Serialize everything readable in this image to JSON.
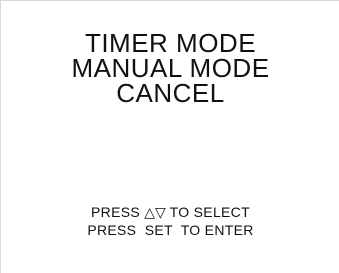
{
  "menu": {
    "items": [
      {
        "label": "TIMER MODE"
      },
      {
        "label": "MANUAL MODE"
      },
      {
        "label": "CANCEL"
      }
    ]
  },
  "instructions": {
    "line1_prefix": "PRESS ",
    "arrows": "△▽",
    "line1_suffix": " TO SELECT",
    "line2": "PRESS  SET  TO ENTER"
  },
  "icons": [
    "up-triangle-icon",
    "down-triangle-icon"
  ]
}
